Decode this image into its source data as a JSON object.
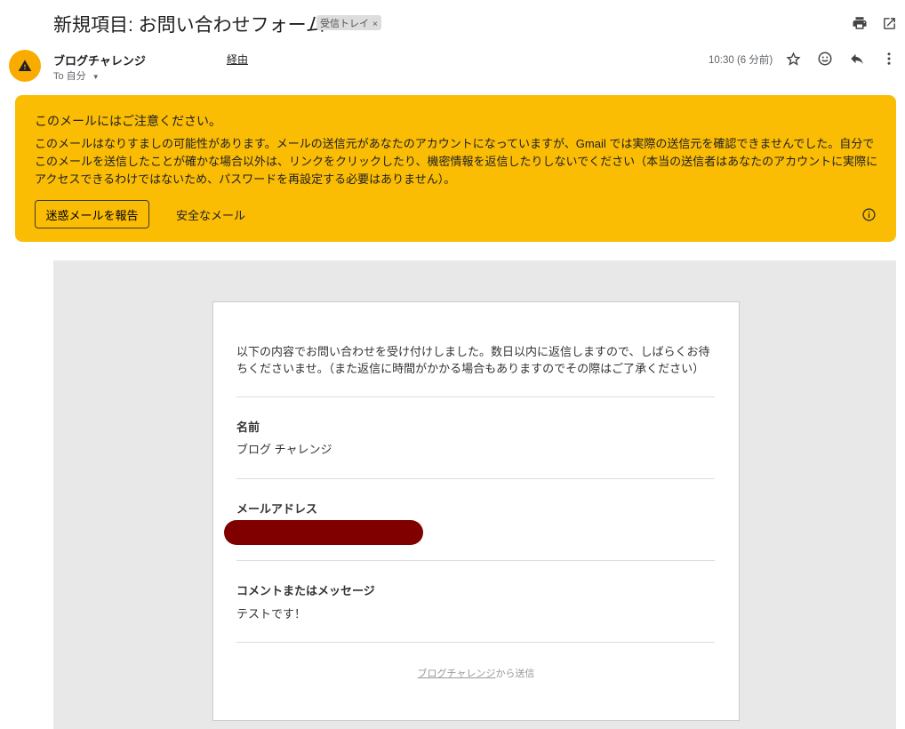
{
  "header": {
    "subject": "新規項目: お問い合わせフォーム",
    "label": "受信トレイ",
    "label_close": "×"
  },
  "message": {
    "sender": "ブログチャレンジ",
    "via": "経由",
    "to": "To 自分",
    "time": "10:30 (6 分前)"
  },
  "warning": {
    "heading": "このメールにはご注意ください。",
    "body": "このメールはなりすましの可能性があります。メールの送信元があなたのアカウントになっていますが、Gmail では実際の送信元を確認できませんでした。自分でこのメールを送信したことが確かな場合以外は、リンクをクリックしたり、機密情報を返信したりしないでください（本当の送信者はあなたのアカウントに実際にアクセスできるわけではないため、パスワードを再設定する必要はありません）。",
    "report_button": "迷惑メールを報告",
    "safe_button": "安全なメール",
    "color": "#fbbc04"
  },
  "body": {
    "intro": "以下の内容でお問い合わせを受け付けしました。数日以内に返信しますので、しばらくお待ちくださいませ。（また返信に時間がかかる場合もありますのでその際はご了承ください）",
    "fields": [
      {
        "label": "名前",
        "value": "ブログ チャレンジ"
      },
      {
        "label": "メールアドレス",
        "value": ""
      },
      {
        "label": "コメントまたはメッセージ",
        "value": "テストです！"
      }
    ],
    "footer_link": "ブログチャレンジ",
    "footer_text": "から送信"
  }
}
